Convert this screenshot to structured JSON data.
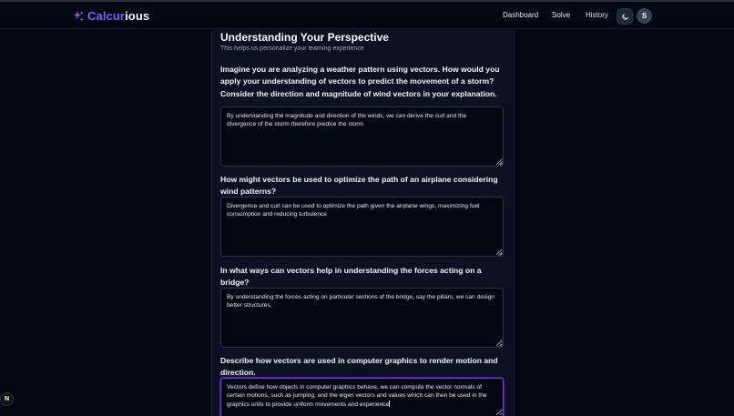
{
  "brand": {
    "part1": "Calcur",
    "part2": "ious"
  },
  "nav": {
    "dashboard": "Dashboard",
    "solve": "Solve",
    "history": "History"
  },
  "user": {
    "initial": "S"
  },
  "section": {
    "title": "Understanding Your Perspective",
    "subtitle": "This helps us personalize your learning experience"
  },
  "questions": [
    {
      "text": "Imagine you are analyzing a weather pattern using vectors. How would you apply your understanding of vectors to predict the movement of a storm? Consider the direction and magnitude of wind vectors in your explanation.",
      "answer": "By understanding the magnitude and direction of the winds, we can derive the curl and the divergence of the storm therefore predice the storm"
    },
    {
      "text": "How might vectors be used to optimize the path of an airplane considering wind patterns?",
      "answer": "Divergence and curl can be used to optimize the path given the airplane wings, maximizing fuel consumption and reducing turbulence"
    },
    {
      "text": "In what ways can vectors help in understanding the forces acting on a bridge?",
      "answer": "By understanding the forces acting on particular sections of the bridge, say the pillars, we can design better structures."
    },
    {
      "text": "Describe how vectors are used in computer graphics to render motion and direction.",
      "answer": "Vectors define how objects in computer graphics behave, we can compute the vector normals of certain motions, such as jumping, and the eigen vectors and values which can then be used in the graphics units to provide uniform movements and experience"
    }
  ],
  "dev_badge": {
    "letter": "N"
  },
  "colors": {
    "accent": "#8b5cf6",
    "background": "#030712",
    "card": "#0b1120"
  }
}
